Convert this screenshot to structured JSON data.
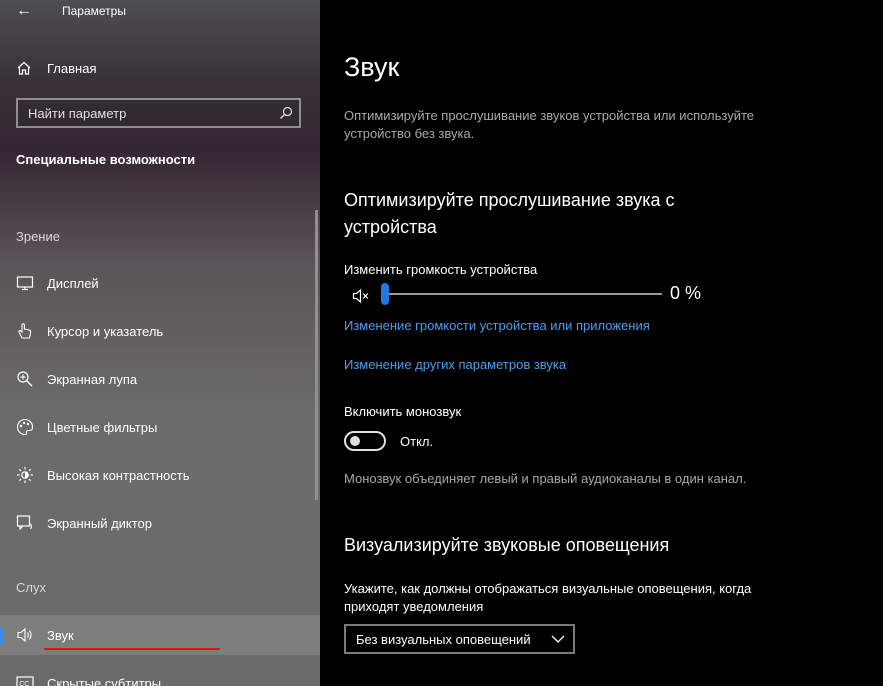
{
  "window": {
    "title": "Параметры",
    "back_icon": "back-arrow-icon"
  },
  "sidebar": {
    "home_label": "Главная",
    "search_placeholder": "Найти параметр",
    "section_title": "Специальные возможности",
    "groups": [
      {
        "label": "Зрение"
      },
      {
        "label": "Слух"
      }
    ],
    "items": [
      {
        "label": "Дисплей",
        "icon": "display-icon"
      },
      {
        "label": "Курсор и указатель",
        "icon": "cursor-icon"
      },
      {
        "label": "Экранная лупа",
        "icon": "magnifier-icon"
      },
      {
        "label": "Цветные фильтры",
        "icon": "color-filter-icon"
      },
      {
        "label": "Высокая контрастность",
        "icon": "contrast-icon"
      },
      {
        "label": "Экранный диктор",
        "icon": "narrator-icon"
      },
      {
        "label": "Звук",
        "icon": "speaker-icon",
        "selected": true
      },
      {
        "label": "Скрытые субтитры",
        "icon": "captions-icon"
      }
    ]
  },
  "main": {
    "title": "Звук",
    "description": "Оптимизируйте прослушивание звуков устройства или используйте устройство без звука.",
    "section1_title": "Оптимизируйте прослушивание звука с устройства",
    "volume_label": "Изменить громкость устройства",
    "volume_value_text": "0 %",
    "volume_level_percent": 0,
    "link1": "Изменение громкости устройства или приложения",
    "link2": "Изменение других параметров звука",
    "mono_label": "Включить монозвук",
    "mono_state": "Откл.",
    "mono_on": false,
    "mono_note": "Монозвук объединяет левый и правый аудиоканалы в один канал.",
    "section2_title": "Визуализируйте звуковые оповещения",
    "visual_label": "Укажите, как должны отображаться визуальные оповещения, когда приходят уведомления",
    "visual_select": "Без визуальных оповещений"
  },
  "colors": {
    "accent": "#1f7ae0",
    "link": "#4c9ef0",
    "annotation": "#e01010"
  }
}
